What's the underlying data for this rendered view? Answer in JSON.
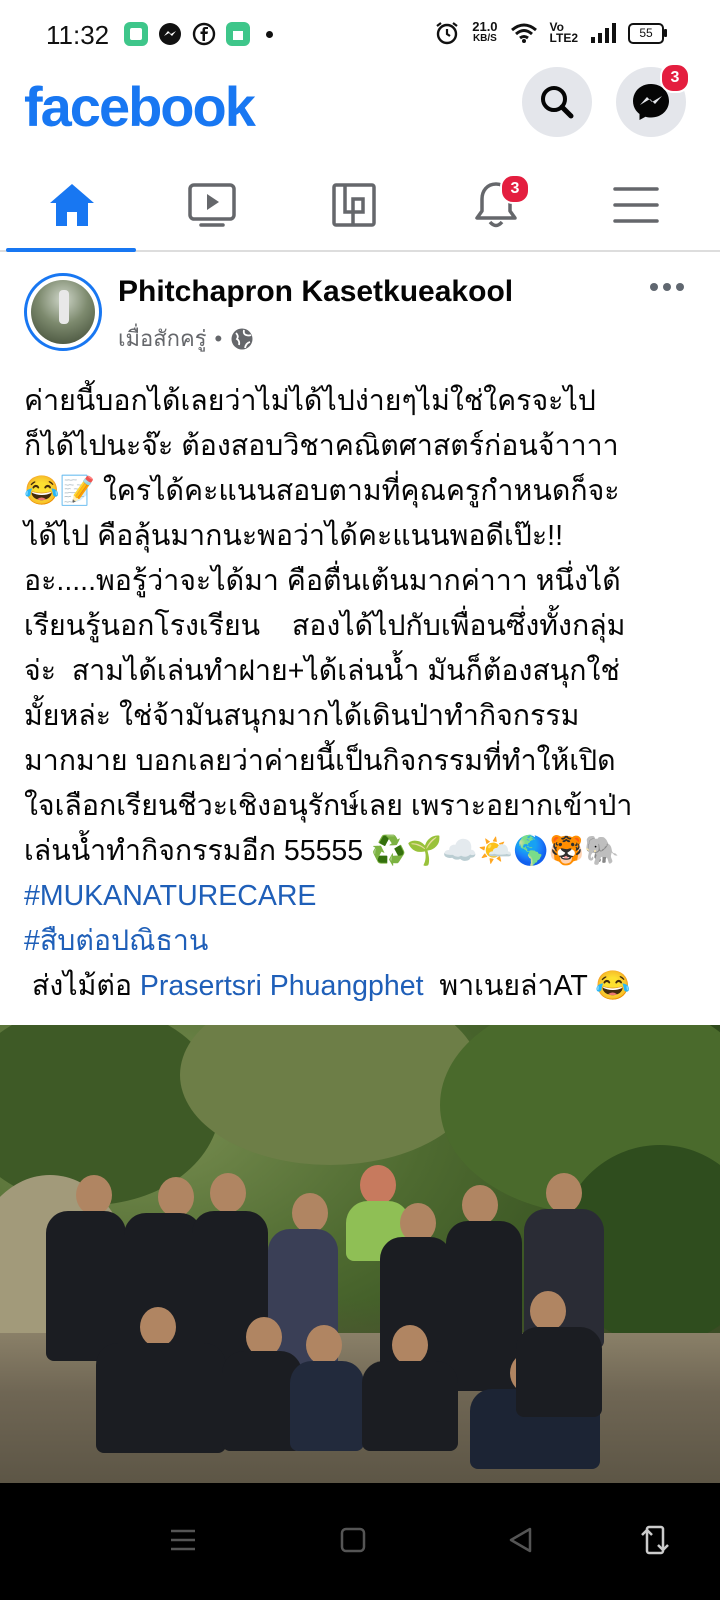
{
  "status_bar": {
    "time": "11:32",
    "net_speed_value": "21.0",
    "net_speed_unit": "KB/S",
    "volte_top": "Vo",
    "volte_bottom": "LTE2",
    "battery": "55"
  },
  "header": {
    "logo": "facebook",
    "messenger_badge": "3"
  },
  "tabs": {
    "notifications_badge": "3"
  },
  "post": {
    "author": "Phitchapron Kasetkueakool",
    "time": "เมื่อสักครู่",
    "separator": "•",
    "text": "ค่ายนี้บอกได้เลยว่าไม่ได้ไปง่ายๆไม่ใช่ใครจะไป\nก็ได้ไปนะจ๊ะ ต้องสอบวิชาคณิตศาสตร์ก่อนจ้าาาา\n😂📝 ใครได้คะแนนสอบตามที่คุณครูกำหนดก็จะ\nได้ไป คือลุ้นมากนะพอว่าได้คะแนนพอดีเป๊ะ!!\nอะ.....พอรู้ว่าจะได้มา คือตื่นเต้นมากค่าาา หนึ่งได้\nเรียนรู้นอกโรงเรียน    สองได้ไปกับเพื่อนซึ่งทั้งกลุ่ม\nจ่ะ  สามได้เล่นทำฝาย+ได้เล่นน้ำ มันก็ต้องสนุกใช่\nมั้ยหล่ะ ใช่จ้ามันสนุกมากได้เดินป่าทำกิจกรรม\nมากมาย บอกเลยว่าค่ายนี้เป็นกิจกรรมที่ทำให้เปิด\nใจเลือกเรียนชีวะเชิงอนุรักษ์เลย เพราะอยากเข้าป่า\nเล่นน้ำทำกิจกรรมอีก 55555 ♻️🌱☁️🌤️🌎🐯🐘",
    "hashtags": [
      "#MUKANATURECARE",
      "#สืบต่อปณิธาน"
    ],
    "pass_prefix": " ส่งไม้ต่อ ",
    "mention": "Prasertsri Phuangphet",
    "pass_suffix": "  พาเนยล่าAT 😂"
  },
  "colors": {
    "brand": "#1877F2",
    "badge": "#E41E3F",
    "secondary_text": "#65676B",
    "hashtag": "#1f5fb8"
  },
  "icons": {
    "status_left": [
      "app-icon",
      "messenger-icon",
      "facebook-icon",
      "store-icon",
      "dot"
    ],
    "status_right": [
      "alarm-icon",
      "wifi-icon",
      "signal-icon",
      "battery-icon"
    ],
    "header": [
      "search-icon",
      "messenger-icon"
    ],
    "tabs": [
      "home-icon",
      "watch-icon",
      "marketplace-icon",
      "bell-icon",
      "menu-icon"
    ],
    "navbar": [
      "menu-lines-icon",
      "square-icon",
      "back-triangle-icon",
      "rotate-icon"
    ]
  }
}
